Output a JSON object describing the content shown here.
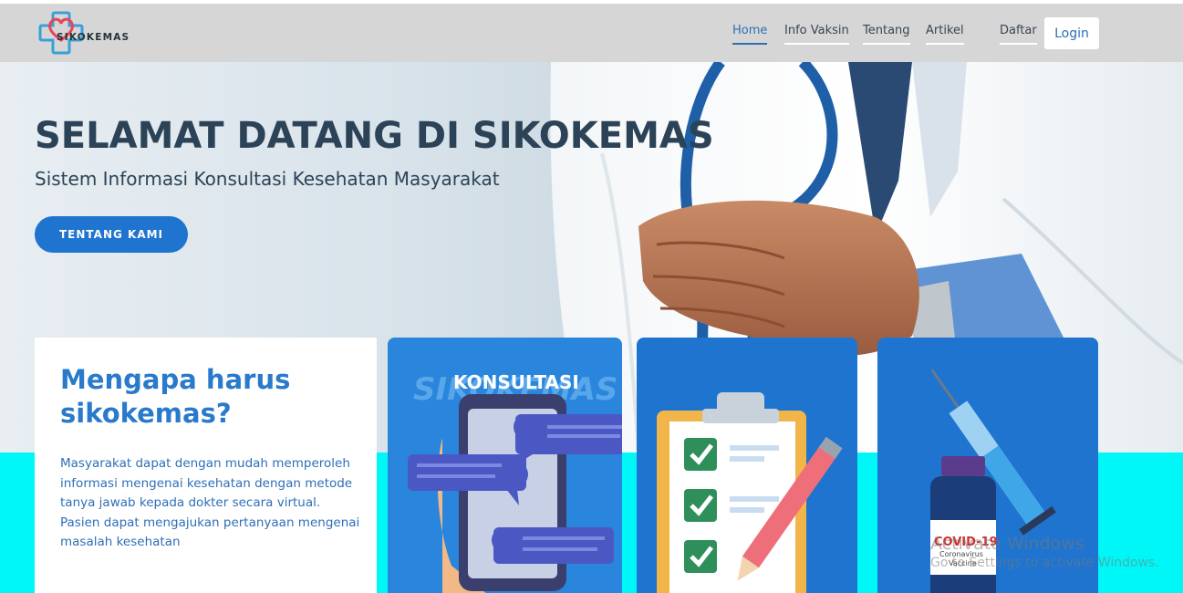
{
  "brand": {
    "name": "SIKOKEMAS"
  },
  "nav": {
    "items": [
      {
        "label": "Home",
        "active": true
      },
      {
        "label": "Info Vaksin",
        "active": false
      },
      {
        "label": "Tentang",
        "active": false
      },
      {
        "label": "Artikel",
        "active": false
      },
      {
        "label": "Daftar",
        "active": false
      }
    ],
    "login_label": "Login"
  },
  "hero": {
    "title": "SELAMAT DATANG DI SIKOKEMAS",
    "subtitle": "Sistem Informasi Konsultasi Kesehatan Masyarakat",
    "button_label": "TENTANG KAMI"
  },
  "why": {
    "title": "Mengapa harus sikokemas?",
    "text": "Masyarakat dapat dengan mudah memperoleh informasi mengenai kesehatan dengan metode tanya jawab kepada dokter secara virtual. Pasien dapat mengajukan pertanyaan mengenai masalah kesehatan"
  },
  "cards": {
    "consult": {
      "heading": "KONSULTASI",
      "watermark": "SIKOKEMAS"
    },
    "checklist": {
      "icon": "clipboard-checklist-icon"
    },
    "vaccine": {
      "label_main": "COVID-19",
      "label_sub1": "Coronavirus",
      "label_sub2": "Vaccine",
      "icon": "vaccine-syringe-icon"
    }
  },
  "os_watermark": {
    "line1": "Activate Windows",
    "line2": "Go to Settings to activate Windows."
  },
  "colors": {
    "primary": "#1e74cf",
    "accent_cyan": "#00f7f7",
    "nav_bg": "#d6d6d6",
    "title_dark": "#2c4357"
  }
}
